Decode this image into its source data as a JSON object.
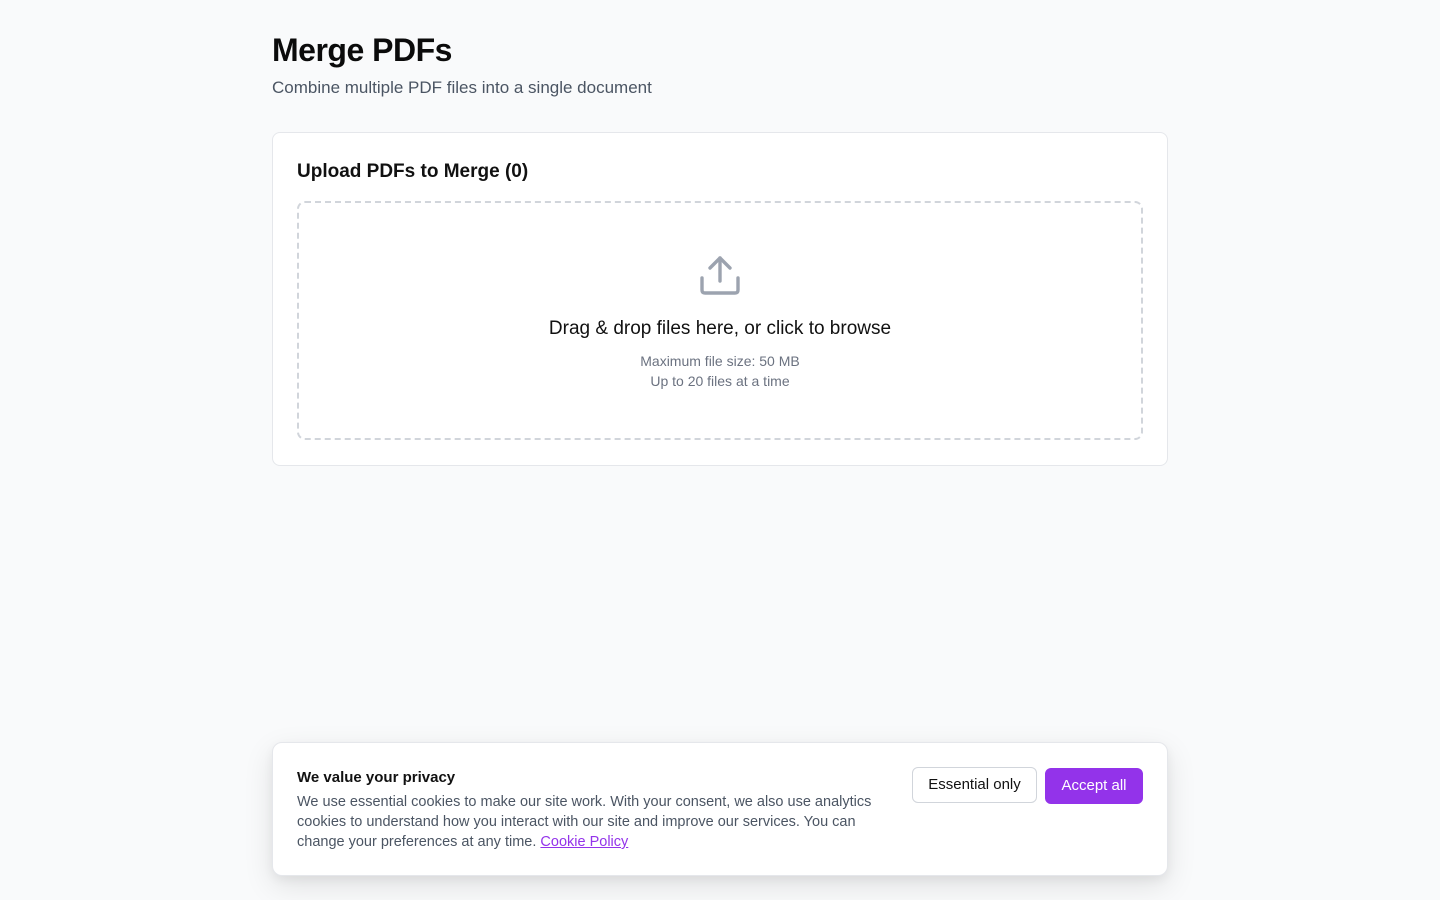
{
  "header": {
    "title": "Merge PDFs",
    "subtitle": "Combine multiple PDF files into a single document"
  },
  "upload": {
    "card_title": "Upload PDFs to Merge (0)",
    "dropzone": {
      "icon": "upload-icon",
      "primary_text": "Drag & drop files here, or click to browse",
      "max_size_text": "Maximum file size: 50 MB",
      "max_count_text": "Up to 20 files at a time"
    }
  },
  "cookie_banner": {
    "title": "We value your privacy",
    "body": "We use essential cookies to make our site work. With your consent, we also use analytics cookies to understand how you interact with our site and improve our services. You can change your preferences at any time.",
    "link_label": "Cookie Policy",
    "essential_label": "Essential only",
    "accept_label": "Accept all"
  },
  "colors": {
    "accent": "#9333ea",
    "background": "#f9fafb",
    "muted_text": "#6b7280",
    "icon": "#9ca3af"
  }
}
